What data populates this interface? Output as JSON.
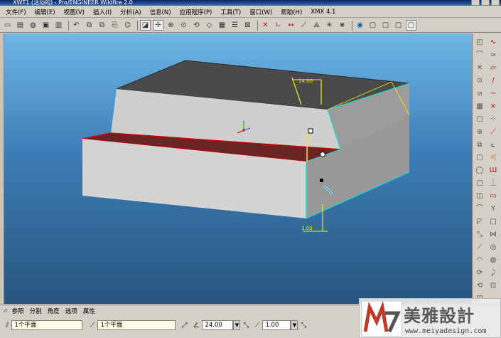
{
  "window": {
    "title": "XWT1 (活动的) - Pro/ENGINEER Wildfire 2.0"
  },
  "menu": [
    {
      "label": "文件(F)"
    },
    {
      "label": "编辑(E)"
    },
    {
      "label": "视图(V)"
    },
    {
      "label": "插入(I)"
    },
    {
      "label": "分析(A)"
    },
    {
      "label": "信息(N)"
    },
    {
      "label": "应用程序(P)"
    },
    {
      "label": "工具(T)"
    },
    {
      "label": "窗口(W)"
    },
    {
      "label": "帮助(H)"
    },
    {
      "label": "XMX 4.1"
    }
  ],
  "toolbar": [
    {
      "icon": "new-file-icon",
      "glyph": "▭"
    },
    {
      "icon": "open-file-icon",
      "glyph": "▤"
    },
    {
      "icon": "open-model-icon",
      "glyph": "◍"
    },
    {
      "icon": "save-icon",
      "glyph": "▣"
    },
    {
      "icon": "print-icon",
      "glyph": "▥"
    },
    {
      "sep": true
    },
    {
      "icon": "undo-icon",
      "glyph": "↶"
    },
    {
      "icon": "redo-icon",
      "glyph": "⧉"
    },
    {
      "icon": "copy-icon",
      "glyph": "⧉"
    },
    {
      "icon": "paste-icon",
      "glyph": "⎘"
    },
    {
      "icon": "regenerate-icon",
      "glyph": "⌬"
    },
    {
      "sep": true
    },
    {
      "icon": "repaint-icon",
      "glyph": "◪",
      "active": true
    },
    {
      "icon": "spin-center-icon",
      "glyph": "✢",
      "active": true
    },
    {
      "icon": "zoom-in-icon",
      "glyph": "⊕"
    },
    {
      "icon": "zoom-out-icon",
      "glyph": "⊙"
    },
    {
      "icon": "refit-icon",
      "glyph": "⟲"
    },
    {
      "icon": "reorient-icon",
      "glyph": "◇"
    },
    {
      "icon": "saved-views-icon",
      "glyph": "▦"
    },
    {
      "icon": "layers-icon",
      "glyph": "☰"
    },
    {
      "icon": "model-tree-icon",
      "glyph": "⊠"
    },
    {
      "sep": true
    },
    {
      "icon": "datum-planes-icon",
      "glyph": "✕",
      "color": "#c01010"
    },
    {
      "icon": "datum-axes-icon",
      "glyph": "∟",
      "color": "#c01010"
    },
    {
      "icon": "datum-points-icon",
      "glyph": "↔",
      "color": "#c01010"
    },
    {
      "icon": "coordinate-system-icon",
      "glyph": "⟋"
    },
    {
      "icon": "sketch-icon",
      "glyph": "⟁"
    },
    {
      "icon": "annotation-icon",
      "glyph": "✳"
    },
    {
      "icon": "datum-point-display-icon",
      "glyph": "⋇"
    },
    {
      "sep": true
    },
    {
      "icon": "wireframe-icon",
      "glyph": "◉",
      "color": "#1a5fb4"
    },
    {
      "icon": "hidden-line-icon",
      "glyph": "▢"
    },
    {
      "icon": "no-hidden-icon",
      "glyph": "▢"
    },
    {
      "icon": "shading-icon",
      "glyph": "▢"
    },
    {
      "icon": "shaded-icon",
      "glyph": "▢",
      "active": true
    }
  ],
  "right_toolbar": [
    {
      "icon": "datum-plane-tool-icon",
      "glyph": "◰"
    },
    {
      "icon": "sketch-curve-icon",
      "glyph": "∿",
      "color": "#c01010"
    },
    {
      "icon": "datum-axis-tool-icon",
      "glyph": "⌒"
    },
    {
      "icon": "wave-curve-icon",
      "glyph": "≈"
    },
    {
      "icon": "datum-point-tool-icon",
      "glyph": "✕"
    },
    {
      "icon": "plane-tool-icon",
      "glyph": "▱",
      "color": "#c01010"
    },
    {
      "icon": "coordinate-tool-icon",
      "glyph": "⊙"
    },
    {
      "icon": "line-tool-icon",
      "glyph": "∕",
      "color": "#c01010"
    },
    {
      "icon": "sketcher-tool-icon",
      "glyph": "⧄"
    },
    {
      "icon": "spline-tool-icon",
      "glyph": "∼",
      "color": "#c01010"
    },
    {
      "icon": "insert-analysis-icon",
      "glyph": "▦"
    },
    {
      "icon": "cross-curve-icon",
      "glyph": "⨯",
      "color": "#c01010"
    },
    {
      "icon": "extrude-tool-icon",
      "glyph": "▢"
    },
    {
      "icon": "points-tool-icon",
      "glyph": "⁘",
      "color": "#c01010"
    },
    {
      "icon": "revolve-tool-icon",
      "glyph": "⊛"
    },
    {
      "icon": "axis-tool-icon",
      "glyph": "⟋",
      "color": "#c01010"
    },
    {
      "icon": "variable-sweep-icon",
      "glyph": "⧉"
    },
    {
      "icon": "csys-tool-icon",
      "glyph": "⟀"
    },
    {
      "icon": "blend-tool-icon",
      "glyph": "▢"
    },
    {
      "icon": "datum-tool-icon",
      "glyph": "⩤",
      "color": "#c06000"
    },
    {
      "icon": "hole-tool-icon",
      "glyph": "◯"
    },
    {
      "icon": "group-tool-icon",
      "glyph": "Ш",
      "color": "#c01010"
    },
    {
      "icon": "shell-tool-icon",
      "glyph": "▢"
    },
    {
      "icon": "rib-tool-icon",
      "glyph": "⏊"
    },
    {
      "icon": "draft-tool-icon",
      "glyph": "◫"
    },
    {
      "icon": "box-tool-icon",
      "glyph": "▭",
      "color": "#c01010"
    },
    {
      "icon": "round-tool-icon",
      "glyph": "⌒"
    },
    {
      "icon": "fold-tool-icon",
      "glyph": "Y"
    },
    {
      "icon": "chamfer-tool-icon",
      "glyph": "◸"
    },
    {
      "icon": "pipe-tool-icon",
      "glyph": "▢"
    },
    {
      "icon": "mirror-tool-icon",
      "glyph": "⤡"
    },
    {
      "icon": "merge-tool-icon",
      "glyph": "⋈"
    },
    {
      "icon": "trim-tool-icon",
      "glyph": "⟋"
    },
    {
      "icon": "pattern-tool-icon",
      "glyph": "◎"
    },
    {
      "icon": "offset-tool-icon",
      "glyph": "◠"
    },
    {
      "icon": "thicken-tool-icon",
      "glyph": "◍"
    },
    {
      "icon": "solidify-tool-icon",
      "glyph": "⟳"
    },
    {
      "icon": "warp-tool-icon",
      "glyph": "⤸"
    },
    {
      "icon": "extend-tool-icon",
      "glyph": "⟲"
    },
    {
      "icon": "intersect-tool-icon",
      "glyph": "⊡"
    },
    {
      "icon": "project-tool-icon",
      "glyph": "◳",
      "color": "#c01010"
    }
  ],
  "viewport": {
    "dimension_top": "24.00",
    "dimension_bottom": "1.00"
  },
  "dashboard": {
    "tabs": [
      "参照",
      "分割",
      "角度",
      "选项",
      "属性"
    ],
    "reference_1": "1个平面",
    "reference_2": "1个平面",
    "angle_value": "24.00",
    "offset_value": "1.00"
  },
  "watermark": {
    "title": "美雅設計",
    "url": "www.meiyadesign.com"
  },
  "colors": {
    "viewport_top": "#6fb6e6",
    "viewport_bottom": "#27557e",
    "highlight_red": "#d00000",
    "edge_cyan": "#00e0e0",
    "dimension_yellow": "#f0f000"
  }
}
